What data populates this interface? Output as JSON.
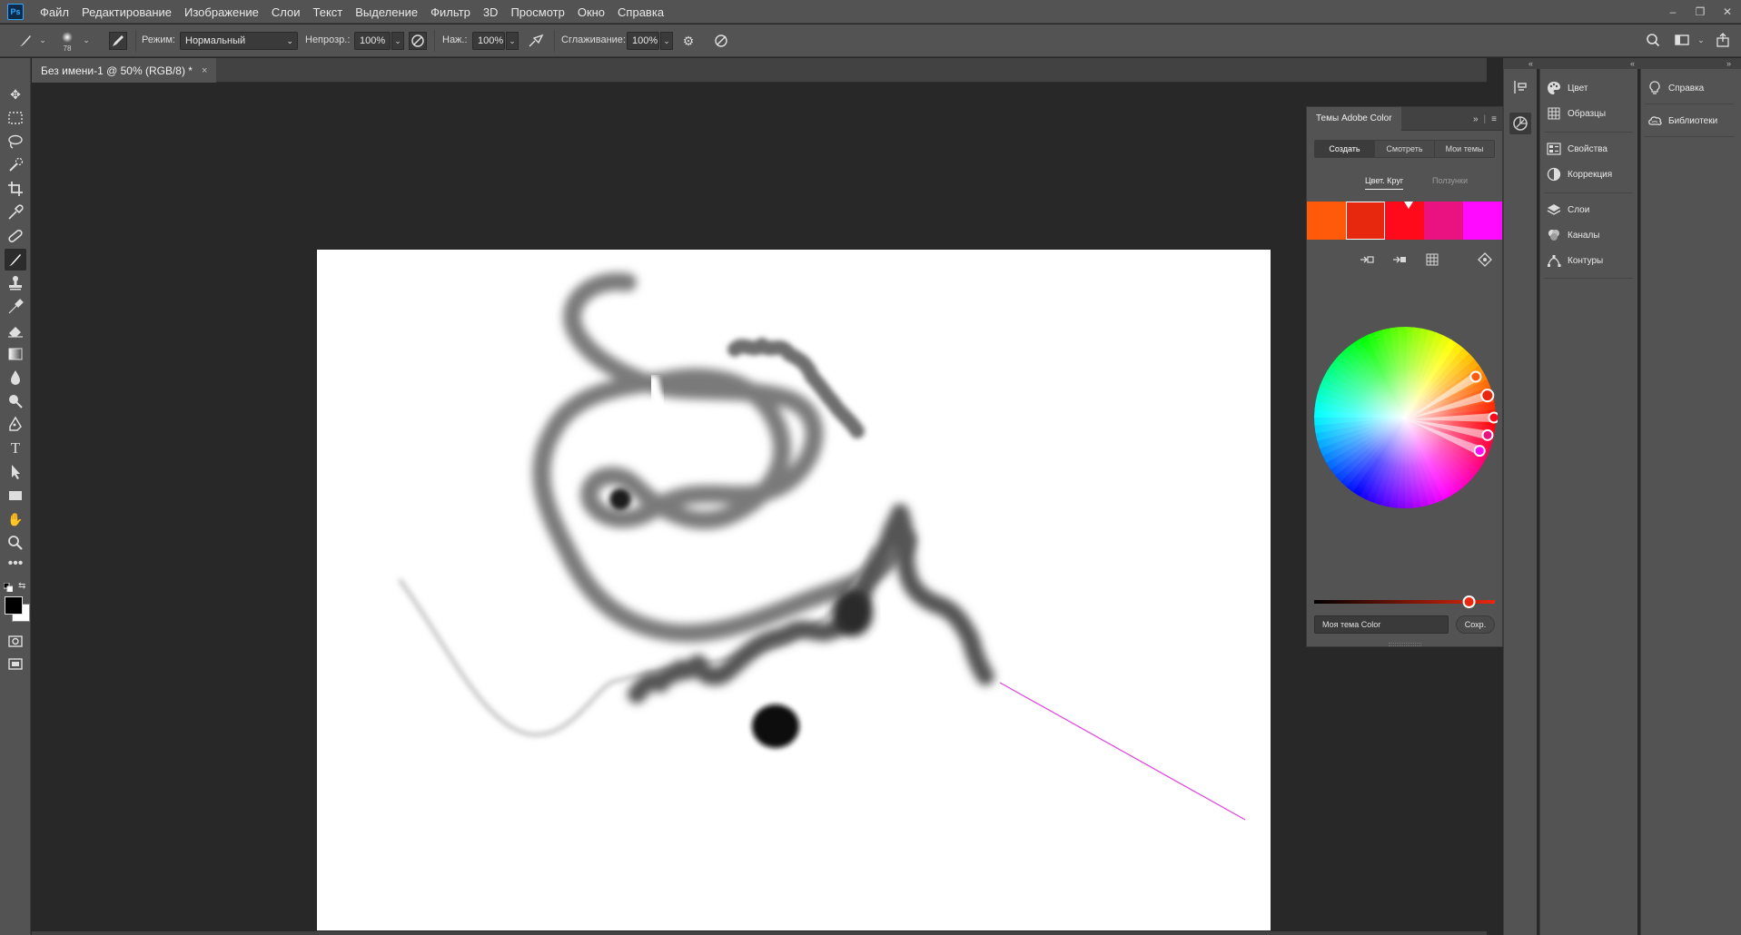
{
  "app": {
    "logo": "Ps",
    "menu": [
      "Файл",
      "Редактирование",
      "Изображение",
      "Слои",
      "Текст",
      "Выделение",
      "Фильтр",
      "3D",
      "Просмотр",
      "Окно",
      "Справка"
    ],
    "window_controls": {
      "minimize": "–",
      "restore": "❐",
      "close": "✕"
    }
  },
  "options_bar": {
    "brush_size": "78",
    "mode_label": "Режим:",
    "mode_value": "Нормальный",
    "opacity_label": "Непрозр.:",
    "opacity_value": "100%",
    "flow_label": "Наж.:",
    "flow_value": "100%",
    "smoothing_label": "Сглаживание:",
    "smoothing_value": "100%"
  },
  "document": {
    "tab_title": "Без имени-1 @ 50% (RGB/8) *",
    "tab_close": "×"
  },
  "color_panel": {
    "title": "Темы Adobe Color",
    "tabs": [
      "Создать",
      "Смотреть",
      "Мои темы"
    ],
    "active_tab": "Создать",
    "subtabs": [
      "Цвет. Круг",
      "Ползунки"
    ],
    "active_subtab": "Цвет. Круг",
    "swatches": [
      "#ff5a0a",
      "#e8280e",
      "#ff0a1a",
      "#ea1280",
      "#ff0aff"
    ],
    "selected_swatch_index": 1,
    "brightness_slider_value": 0.88,
    "theme_name": "Моя тема Color",
    "save_label": "Сохр."
  },
  "right_panels": {
    "group1": [
      {
        "icon": "color-palette-icon",
        "label": "Цвет"
      },
      {
        "icon": "swatches-grid-icon",
        "label": "Образцы"
      }
    ],
    "group2": [
      {
        "icon": "properties-icon",
        "label": "Свойства"
      },
      {
        "icon": "adjustments-icon",
        "label": "Коррекция"
      }
    ],
    "group3": [
      {
        "icon": "layers-icon",
        "label": "Слои"
      },
      {
        "icon": "channels-icon",
        "label": "Каналы"
      },
      {
        "icon": "paths-icon",
        "label": "Контуры"
      }
    ],
    "column2": [
      {
        "icon": "lightbulb-icon",
        "label": "Справка"
      },
      {
        "icon": "libraries-icon",
        "label": "Библиотеки"
      }
    ]
  },
  "colors": {
    "ui_dark": "#535353",
    "workspace": "#282828",
    "foreground_swatch": "#000000",
    "background_swatch": "#ffffff",
    "guide_line": "#e040e0"
  }
}
